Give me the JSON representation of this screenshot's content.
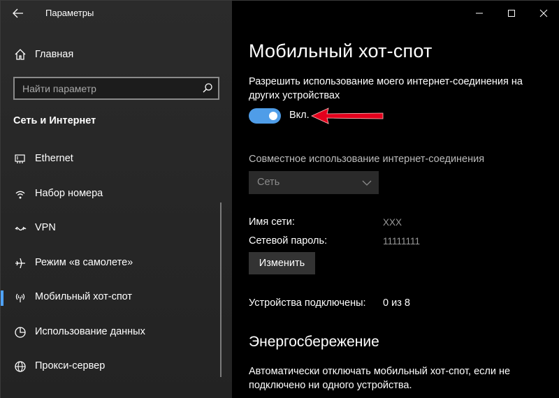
{
  "window": {
    "app_title": "Параметры"
  },
  "sidebar": {
    "home_label": "Главная",
    "search": {
      "placeholder": "Найти параметр"
    },
    "section_title": "Сеть и Интернет",
    "items": [
      {
        "label": "Ethernet",
        "icon": "ethernet-icon"
      },
      {
        "label": "Набор номера",
        "icon": "dialup-icon"
      },
      {
        "label": "VPN",
        "icon": "vpn-icon"
      },
      {
        "label": "Режим «в самолете»",
        "icon": "airplane-icon"
      },
      {
        "label": "Мобильный хот-спот",
        "icon": "hotspot-icon",
        "selected": true
      },
      {
        "label": "Использование данных",
        "icon": "data-usage-icon"
      },
      {
        "label": "Прокси-сервер",
        "icon": "globe-icon"
      }
    ],
    "accent_color": "#4fa3ff"
  },
  "main": {
    "title": "Мобильный хот-спот",
    "share_description": "Разрешить использование моего интернет-соединения на других устройствах",
    "toggle": {
      "state": "on",
      "label": "Вкл."
    },
    "share_from_label": "Совместное использование интернет-соединения",
    "share_from_value": "Сеть",
    "network_name_label": "Имя сети:",
    "network_name_value": "XXX",
    "password_label": "Сетевой пароль:",
    "password_value": "11111111",
    "edit_button": "Изменить",
    "devices_label": "Устройства подключены:",
    "devices_value": "0 из 8",
    "power_heading": "Энергосбережение",
    "power_description": "Автоматически отключать мобильный хот-спот, если не подключено ни одного устройства."
  },
  "colors": {
    "toggle_on": "#4f9de8",
    "annotation_arrow": "#e3001b"
  }
}
